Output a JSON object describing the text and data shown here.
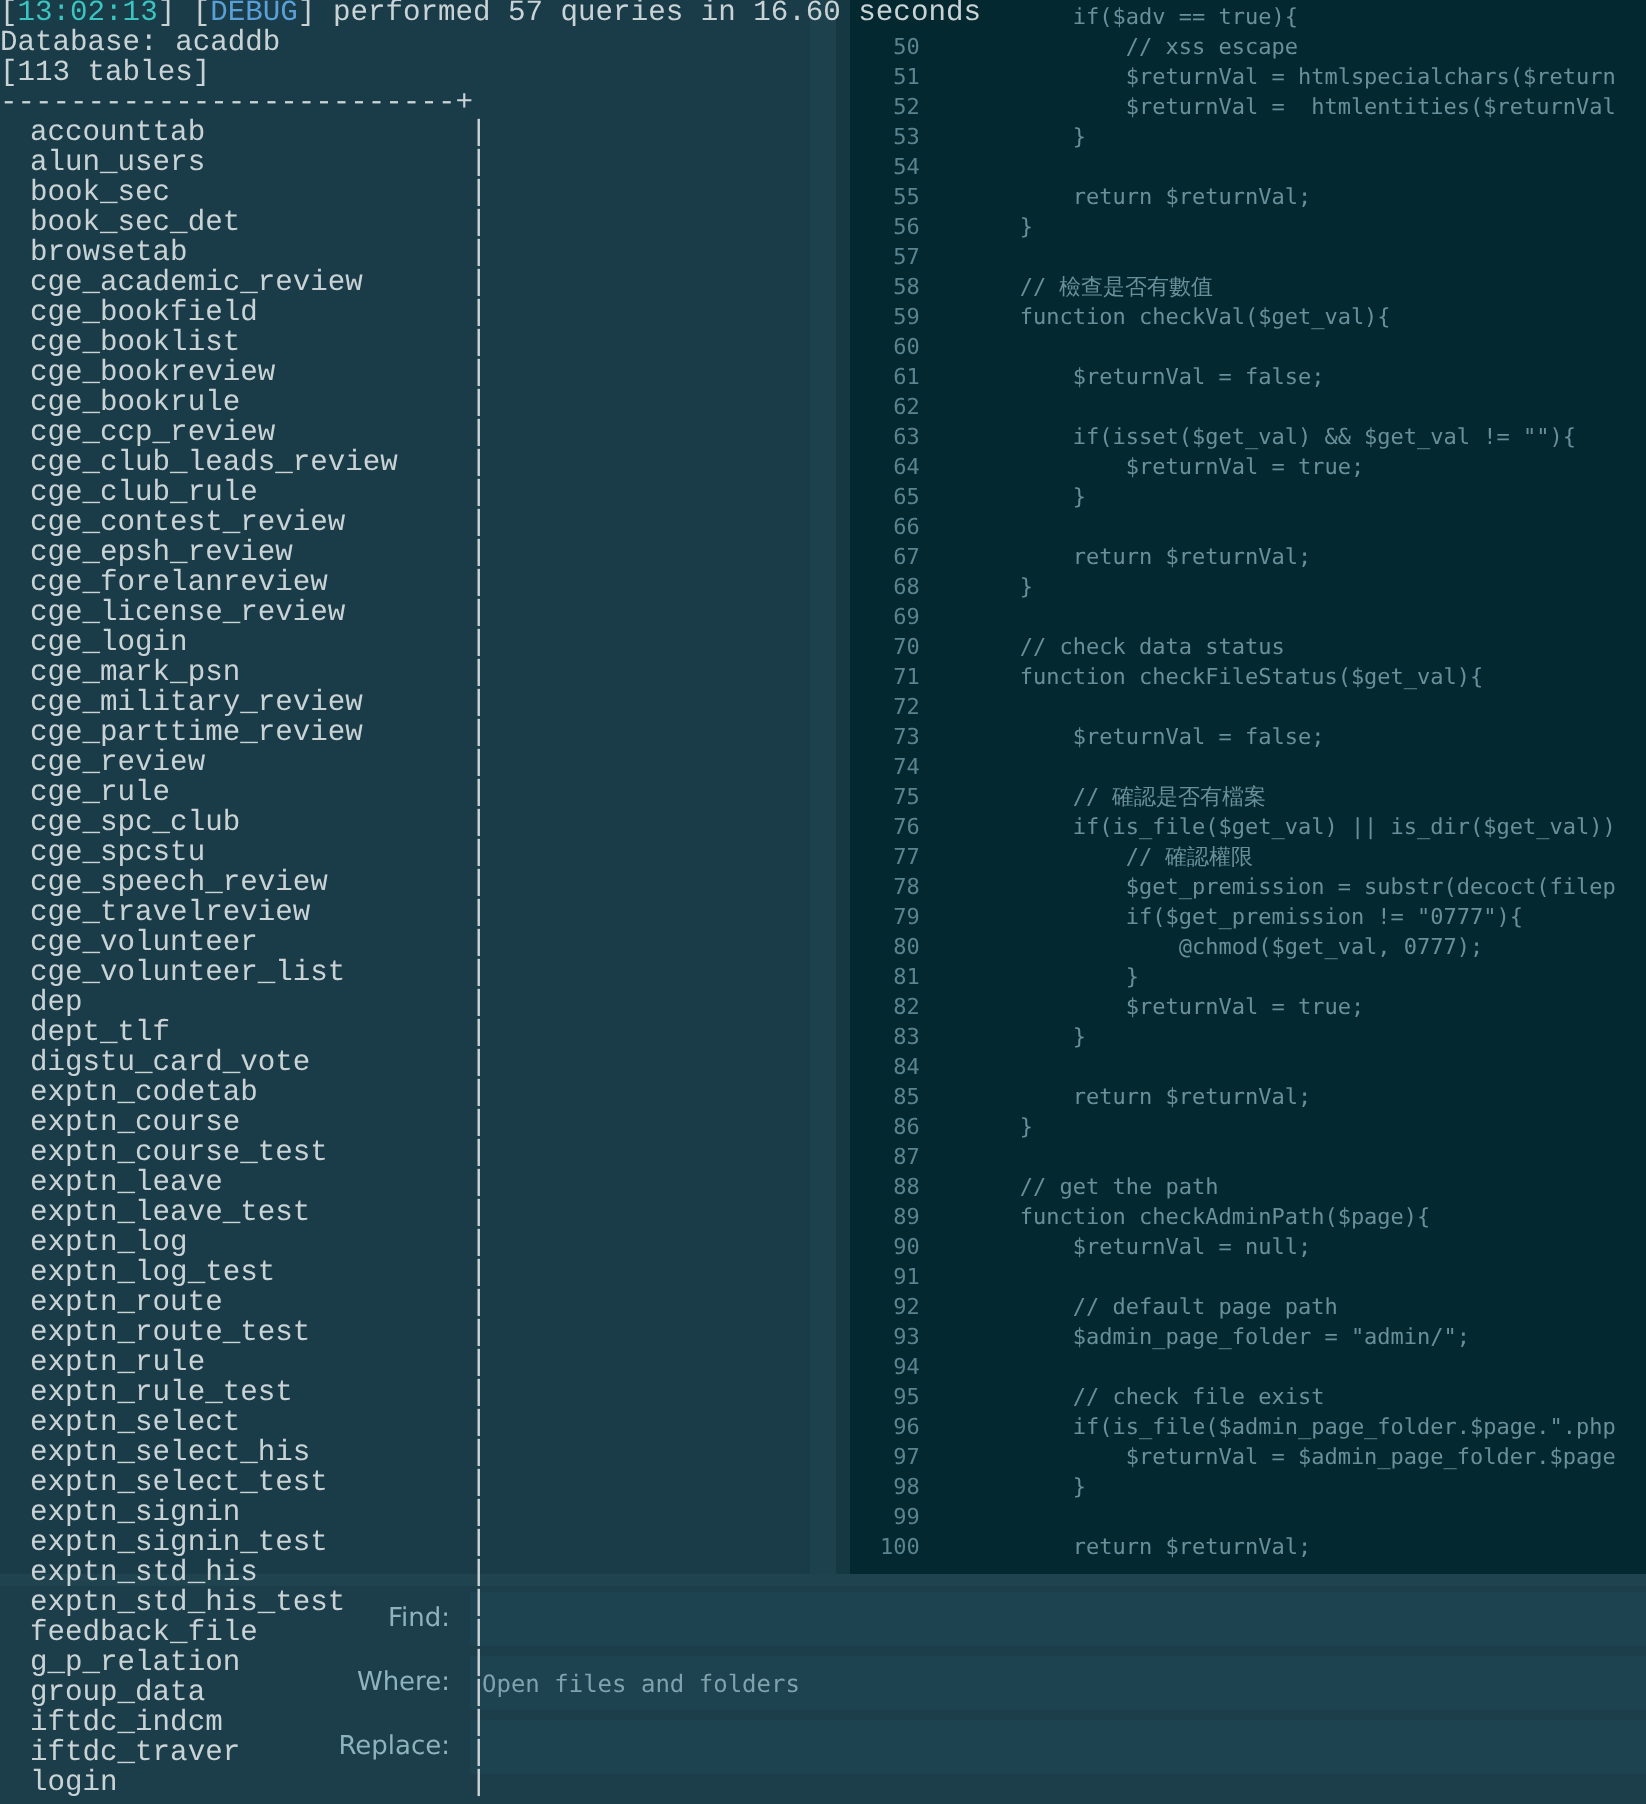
{
  "terminal": {
    "log": {
      "open": "[",
      "time": "13:02:13",
      "mid": "] [",
      "level": "DEBUG",
      "close": "]",
      "message": "performed 57 queries in 16.60 seconds"
    },
    "database_line": "Database: acaddb",
    "count_line": "[113 tables]",
    "top_border": "--------------------------+",
    "rows": [
      {
        "name": "accounttab",
        "border": "|"
      },
      {
        "name": "alun_users",
        "border": "|"
      },
      {
        "name": "book_sec",
        "border": "|"
      },
      {
        "name": "book_sec_det",
        "border": "|"
      },
      {
        "name": "browsetab",
        "border": "|"
      },
      {
        "name": "cge_academic_review",
        "border": "|"
      },
      {
        "name": "cge_bookfield",
        "border": "|"
      },
      {
        "name": "cge_booklist",
        "border": "|"
      },
      {
        "name": "cge_bookreview",
        "border": "|"
      },
      {
        "name": "cge_bookrule",
        "border": "|"
      },
      {
        "name": "cge_ccp_review",
        "border": "|"
      },
      {
        "name": "cge_club_leads_review",
        "border": "|"
      },
      {
        "name": "cge_club_rule",
        "border": "|"
      },
      {
        "name": "cge_contest_review",
        "border": "|"
      },
      {
        "name": "cge_epsh_review",
        "border": "|"
      },
      {
        "name": "cge_forelanreview",
        "border": "|"
      },
      {
        "name": "cge_license_review",
        "border": "|"
      },
      {
        "name": "cge_login",
        "border": "|"
      },
      {
        "name": "cge_mark_psn",
        "border": "|"
      },
      {
        "name": "cge_military_review",
        "border": "|"
      },
      {
        "name": "cge_parttime_review",
        "border": "|"
      },
      {
        "name": "cge_review",
        "border": "|"
      },
      {
        "name": "cge_rule",
        "border": "|"
      },
      {
        "name": "cge_spc_club",
        "border": "|"
      },
      {
        "name": "cge_spcstu",
        "border": "|"
      },
      {
        "name": "cge_speech_review",
        "border": "|"
      },
      {
        "name": "cge_travelreview",
        "border": "|"
      },
      {
        "name": "cge_volunteer",
        "border": "|"
      },
      {
        "name": "cge_volunteer_list",
        "border": "|"
      },
      {
        "name": "dep",
        "border": "|"
      },
      {
        "name": "dept_tlf",
        "border": "|"
      },
      {
        "name": "digstu_card_vote",
        "border": "|"
      },
      {
        "name": "exptn_codetab",
        "border": "|"
      },
      {
        "name": "exptn_course",
        "border": "|"
      },
      {
        "name": "exptn_course_test",
        "border": "|"
      },
      {
        "name": "exptn_leave",
        "border": "|"
      },
      {
        "name": "exptn_leave_test",
        "border": "|"
      },
      {
        "name": "exptn_log",
        "border": "|"
      },
      {
        "name": "exptn_log_test",
        "border": "|"
      },
      {
        "name": "exptn_route",
        "border": "|"
      },
      {
        "name": "exptn_route_test",
        "border": "|"
      },
      {
        "name": "exptn_rule",
        "border": "|"
      },
      {
        "name": "exptn_rule_test",
        "border": "|"
      },
      {
        "name": "exptn_select",
        "border": "|"
      },
      {
        "name": "exptn_select_his",
        "border": "|"
      },
      {
        "name": "exptn_select_test",
        "border": "|"
      },
      {
        "name": "exptn_signin",
        "border": "|"
      },
      {
        "name": "exptn_signin_test",
        "border": "|"
      },
      {
        "name": "exptn_std_his",
        "border": "|"
      },
      {
        "name": "exptn_std_his_test",
        "border": "|"
      },
      {
        "name": "feedback_file",
        "border": "|"
      },
      {
        "name": "g_p_relation",
        "border": "|"
      },
      {
        "name": "group_data",
        "border": "|"
      },
      {
        "name": "iftdc_indcm",
        "border": "|"
      },
      {
        "name": "iftdc_traver",
        "border": "|"
      },
      {
        "name": "login",
        "border": "|"
      }
    ]
  },
  "editor": {
    "lines": [
      {
        "code": "    if($adv == true){"
      },
      {
        "number": "50",
        "code": "        // xss escape"
      },
      {
        "number": "51",
        "code": "        $returnVal = htmlspecialchars($return"
      },
      {
        "number": "52",
        "code": "        $returnVal =  htmlentities($returnVal"
      },
      {
        "number": "53",
        "code": "    }"
      },
      {
        "number": "54"
      },
      {
        "number": "55",
        "code": "    return $returnVal;"
      },
      {
        "number": "56",
        "code": "}"
      },
      {
        "number": "57"
      },
      {
        "number": "58",
        "code": "// 檢查是否有數值"
      },
      {
        "number": "59",
        "code": "function checkVal($get_val){"
      },
      {
        "number": "60"
      },
      {
        "number": "61",
        "code": "    $returnVal = false;"
      },
      {
        "number": "62"
      },
      {
        "number": "63",
        "code": "    if(isset($get_val) && $get_val != \"\"){"
      },
      {
        "number": "64",
        "code": "        $returnVal = true;"
      },
      {
        "number": "65",
        "code": "    }"
      },
      {
        "number": "66"
      },
      {
        "number": "67",
        "code": "    return $returnVal;"
      },
      {
        "number": "68",
        "code": "}"
      },
      {
        "number": "69"
      },
      {
        "number": "70",
        "code": "// check data status"
      },
      {
        "number": "71",
        "code": "function checkFileStatus($get_val){"
      },
      {
        "number": "72"
      },
      {
        "number": "73",
        "code": "    $returnVal = false;"
      },
      {
        "number": "74"
      },
      {
        "number": "75",
        "code": "    // 確認是否有檔案"
      },
      {
        "number": "76",
        "code": "    if(is_file($get_val) || is_dir($get_val))"
      },
      {
        "number": "77",
        "code": "        // 確認權限"
      },
      {
        "number": "78",
        "code": "        $get_premission = substr(decoct(filep"
      },
      {
        "number": "79",
        "code": "        if($get_premission != \"0777\"){"
      },
      {
        "number": "80",
        "code": "            @chmod($get_val, 0777);"
      },
      {
        "number": "81",
        "code": "        }"
      },
      {
        "number": "82",
        "code": "        $returnVal = true;"
      },
      {
        "number": "83",
        "code": "    }"
      },
      {
        "number": "84"
      },
      {
        "number": "85",
        "code": "    return $returnVal;"
      },
      {
        "number": "86",
        "code": "}"
      },
      {
        "number": "87"
      },
      {
        "number": "88",
        "code": "// get the path"
      },
      {
        "number": "89",
        "code": "function checkAdminPath($page){"
      },
      {
        "number": "90",
        "code": "    $returnVal = null;"
      },
      {
        "number": "91"
      },
      {
        "number": "92",
        "code": "    // default page path"
      },
      {
        "number": "93",
        "code": "    $admin_page_folder = \"admin/\";"
      },
      {
        "number": "94"
      },
      {
        "number": "95",
        "code": "    // check file exist"
      },
      {
        "number": "96",
        "code": "    if(is_file($admin_page_folder.$page.\".php"
      },
      {
        "number": "97",
        "code": "        $returnVal = $admin_page_folder.$page"
      },
      {
        "number": "98",
        "code": "    }"
      },
      {
        "number": "99"
      },
      {
        "number": "100",
        "code": "    return $returnVal;"
      }
    ]
  },
  "find_panel": {
    "fields": [
      {
        "label": "Find:"
      },
      {
        "label": "Where:",
        "placeholder": "Open files and folders"
      },
      {
        "label": "Replace:"
      }
    ]
  }
}
